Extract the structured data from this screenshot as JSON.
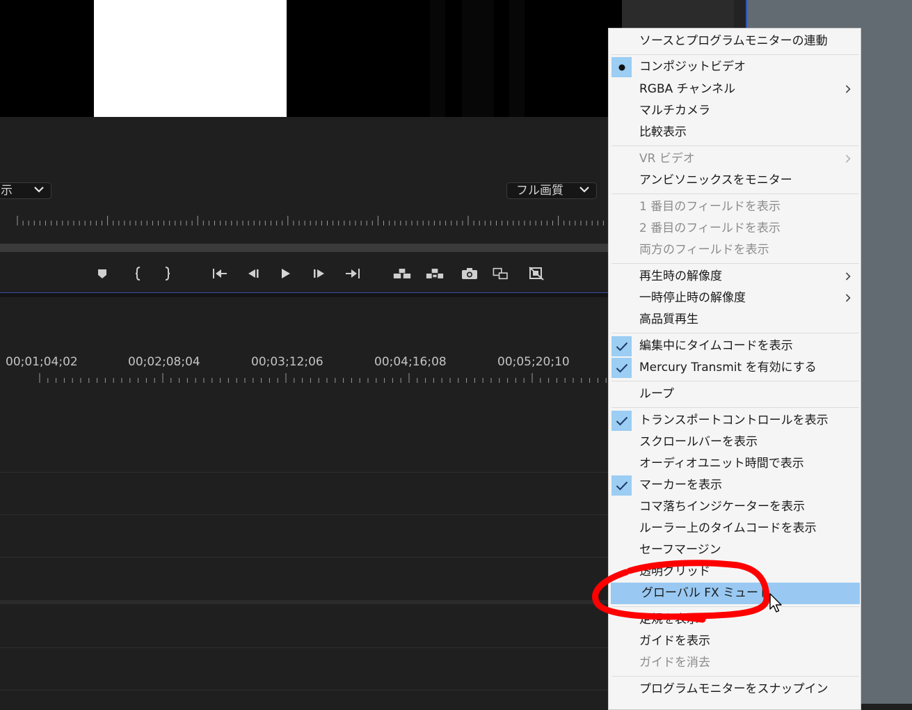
{
  "monitor": {
    "left_dropdown_text": "示",
    "quality_dropdown_text": "フル画質"
  },
  "timeline": {
    "timecodes": [
      "00;01;04;02",
      "00;02;08;04",
      "00;03;12;06",
      "00;04;16;08",
      "00;05;20;10"
    ]
  },
  "transport_icons": [
    "marker-icon",
    "mark-in-icon",
    "mark-out-icon",
    "go-to-in-icon",
    "step-back-icon",
    "play-icon",
    "step-forward-icon",
    "go-to-out-icon",
    "insert-icon",
    "overwrite-icon",
    "export-frame-icon",
    "comparison-view-icon",
    "proxy-toggle-icon"
  ],
  "menu": {
    "items": [
      {
        "label": "ソースとプログラムモニターの連動",
        "mark": "",
        "submenu": false,
        "disabled": false
      },
      {
        "label": "コンポジットビデオ",
        "mark": "dot",
        "submenu": false,
        "disabled": false
      },
      {
        "label": "RGBA チャンネル",
        "mark": "",
        "submenu": true,
        "disabled": false
      },
      {
        "label": "マルチカメラ",
        "mark": "",
        "submenu": false,
        "disabled": false
      },
      {
        "label": "比較表示",
        "mark": "",
        "submenu": false,
        "disabled": false
      },
      {
        "label": "VR ビデオ",
        "mark": "",
        "submenu": true,
        "disabled": true
      },
      {
        "label": "アンビソニックスをモニター",
        "mark": "",
        "submenu": false,
        "disabled": false
      },
      {
        "label": "1 番目のフィールドを表示",
        "mark": "",
        "submenu": false,
        "disabled": true
      },
      {
        "label": "2 番目のフィールドを表示",
        "mark": "",
        "submenu": false,
        "disabled": true
      },
      {
        "label": "両方のフィールドを表示",
        "mark": "",
        "submenu": false,
        "disabled": true
      },
      {
        "label": "再生時の解像度",
        "mark": "",
        "submenu": true,
        "disabled": false
      },
      {
        "label": "一時停止時の解像度",
        "mark": "",
        "submenu": true,
        "disabled": false
      },
      {
        "label": "高品質再生",
        "mark": "",
        "submenu": false,
        "disabled": false
      },
      {
        "label": "編集中にタイムコードを表示",
        "mark": "check",
        "submenu": false,
        "disabled": false
      },
      {
        "label": "Mercury Transmit を有効にする",
        "mark": "check",
        "submenu": false,
        "disabled": false
      },
      {
        "label": "ループ",
        "mark": "",
        "submenu": false,
        "disabled": false
      },
      {
        "label": "トランスポートコントロールを表示",
        "mark": "check",
        "submenu": false,
        "disabled": false
      },
      {
        "label": "スクロールバーを表示",
        "mark": "",
        "submenu": false,
        "disabled": false
      },
      {
        "label": "オーディオユニット時間で表示",
        "mark": "",
        "submenu": false,
        "disabled": false
      },
      {
        "label": "マーカーを表示",
        "mark": "check",
        "submenu": false,
        "disabled": false
      },
      {
        "label": "コマ落ちインジケーターを表示",
        "mark": "",
        "submenu": false,
        "disabled": false
      },
      {
        "label": "ルーラー上のタイムコードを表示",
        "mark": "",
        "submenu": false,
        "disabled": false
      },
      {
        "label": "セーフマージン",
        "mark": "",
        "submenu": false,
        "disabled": false
      },
      {
        "label": "透明グリッド",
        "mark": "",
        "submenu": false,
        "disabled": false
      },
      {
        "label": "グローバル FX ミュート",
        "mark": "",
        "submenu": false,
        "disabled": false,
        "highlighted": true
      },
      {
        "label": "定規を表示",
        "mark": "",
        "submenu": false,
        "disabled": false
      },
      {
        "label": "ガイドを表示",
        "mark": "",
        "submenu": false,
        "disabled": false
      },
      {
        "label": "ガイドを消去",
        "mark": "",
        "submenu": false,
        "disabled": true
      },
      {
        "label": "プログラムモニターをスナップイン",
        "mark": "",
        "submenu": false,
        "disabled": false
      }
    ]
  },
  "colors": {
    "highlight": "#99c9f2",
    "annotation": "#ff0000"
  }
}
